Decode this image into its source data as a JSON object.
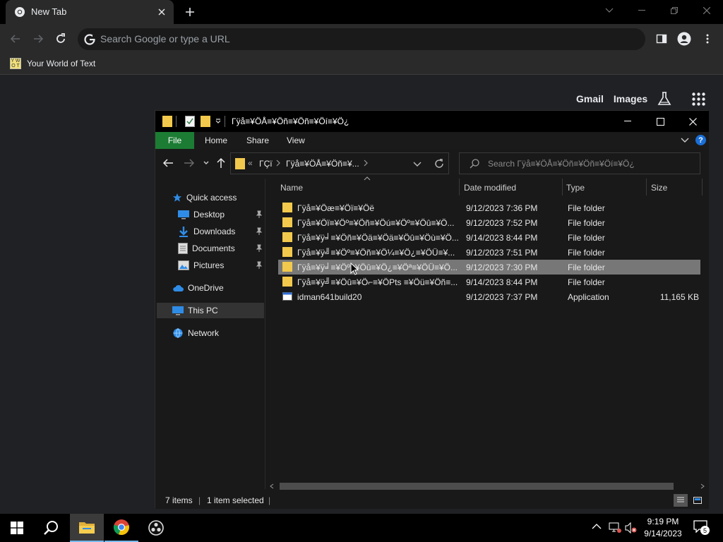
{
  "browser": {
    "tab_title": "New Tab",
    "omnibox_placeholder": "Search Google or type a URL",
    "bookmark_label": "Your World of Text",
    "ntp_links": [
      "Gmail",
      "Images"
    ]
  },
  "explorer": {
    "window_title": "Γÿå≡¥ÖÅ≡¥Öñ≡¥Öñ≡¥Öí≡¥Ö¿",
    "ribbon_tabs": [
      "File",
      "Home",
      "Share",
      "View"
    ],
    "breadcrumb": [
      "ΓÇï",
      "Γÿå≡¥ÖÅ≡¥Öñ≡¥..."
    ],
    "search_placeholder": "Search Γÿå≡¥ÖÅ≡¥Öñ≡¥Öñ≡¥Öí≡¥Ö¿",
    "nav": {
      "quick_access": "Quick access",
      "desktop": "Desktop",
      "downloads": "Downloads",
      "documents": "Documents",
      "pictures": "Pictures",
      "onedrive": "OneDrive",
      "this_pc": "This PC",
      "network": "Network"
    },
    "columns": {
      "name": "Name",
      "date_modified": "Date modified",
      "type": "Type",
      "size": "Size"
    },
    "files": [
      {
        "name": "Γÿå≡¥Öæ≡¥Öï≡¥Öë",
        "date": "9/12/2023 7:36 PM",
        "type": "File folder",
        "size": ""
      },
      {
        "name": "Γÿå≡¥Öï≡¥Öº≡¥Öñ≡¥Öú≡¥Öº≡¥Öû≡¥Ö...",
        "date": "9/12/2023 7:52 PM",
        "type": "File folder",
        "size": ""
      },
      {
        "name": "Γÿå≡¥ÿ╛≡¥Öñ≡¥Öä≡¥Öä≡¥Öû≡¥Öù≡¥Ö...",
        "date": "9/14/2023 8:44 PM",
        "type": "File folder",
        "size": ""
      },
      {
        "name": "Γÿå≡¥ÿ╝≡¥Öº≡¥Öñ≡¥Ö¼≡¥Ö¿≡¥ÖÜ≡¥...",
        "date": "9/12/2023 7:51 PM",
        "type": "File folder",
        "size": ""
      },
      {
        "name": "Γÿå≡¥ÿ╛≡¥Öº≡¥Öû≡¥Ö¿≡¥Öª≡¥ÖÜ≡¥Ö...",
        "date": "9/12/2023 7:30 PM",
        "type": "File folder",
        "size": ""
      },
      {
        "name": "Γÿå≡¥ÿ╝≡¥Öû≡¥Ö⌐≡¥ÖPts ≡¥Öü≡¥Öñ≡...",
        "date": "9/14/2023 8:44 PM",
        "type": "File folder",
        "size": ""
      },
      {
        "name": "idman641build20",
        "date": "9/12/2023 7:37 PM",
        "type": "Application",
        "size": "11,165 KB"
      }
    ],
    "status": {
      "items": "7 items",
      "selected": "1 item selected"
    }
  },
  "taskbar": {
    "time": "9:19 PM",
    "date": "9/14/2023",
    "notification_count": "5"
  },
  "colors": {
    "file_tab_green": "#1c7c34",
    "selected_row": "#777777",
    "folder_yellow": "#f2c94c"
  }
}
